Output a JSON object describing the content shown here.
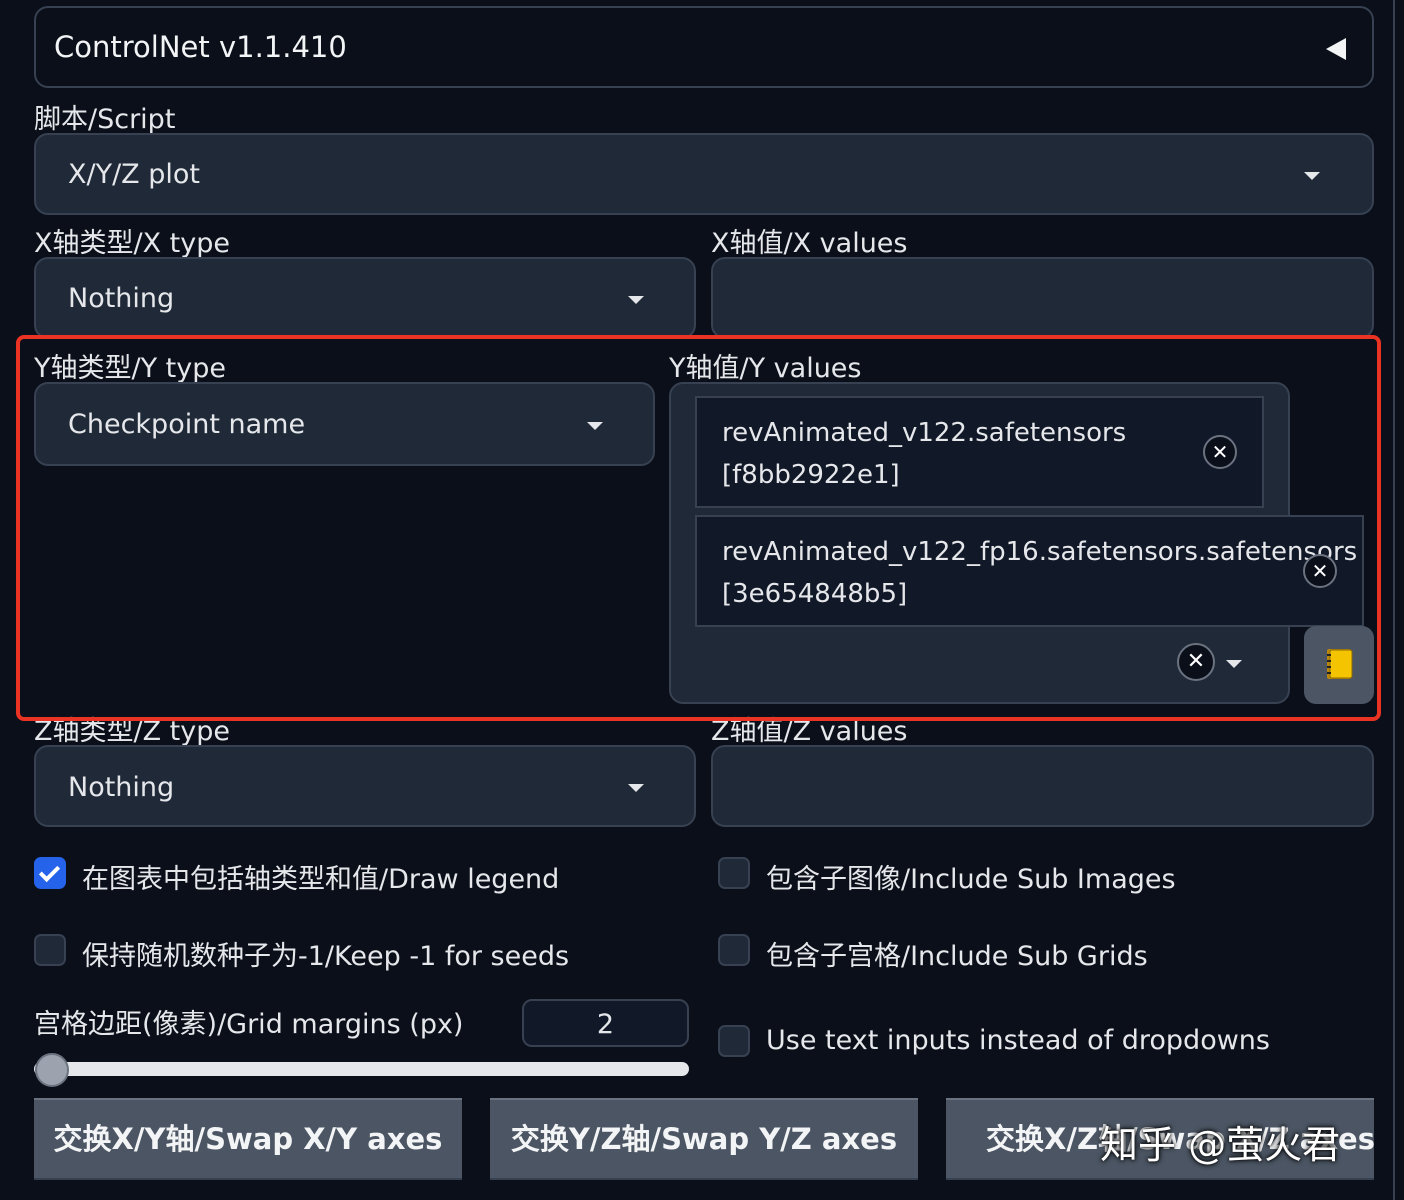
{
  "accordion": {
    "title": "ControlNet v1.1.410",
    "collapse_icon": "triangle-left-icon"
  },
  "script": {
    "label": "脚本/Script",
    "value": "X/Y/Z plot"
  },
  "x_axis": {
    "type_label": "X轴类型/X type",
    "type_value": "Nothing",
    "values_label": "X轴值/X values",
    "values_value": ""
  },
  "y_axis": {
    "type_label": "Y轴类型/Y type",
    "type_value": "Checkpoint name",
    "values_label": "Y轴值/Y values",
    "selected": [
      {
        "line1": "revAnimated_v122.safetensors",
        "line2": "[f8bb2922e1]"
      },
      {
        "line1": "revAnimated_v122_fp16.safetensors.safetensors",
        "line2": "[3e654848b5]"
      }
    ],
    "clear_icon": "close-icon",
    "open_icon": "chevron-down-icon",
    "fill_button_icon": "notebook-icon"
  },
  "z_axis": {
    "type_label": "Z轴类型/Z type",
    "type_value": "Nothing",
    "values_label": "Z轴值/Z values",
    "values_value": ""
  },
  "options": {
    "draw_legend": {
      "label": "在图表中包括轴类型和值/Draw legend",
      "checked": true
    },
    "include_sub_images": {
      "label": "包含子图像/Include Sub Images",
      "checked": false
    },
    "keep_seeds": {
      "label": "保持随机数种子为-1/Keep -1 for seeds",
      "checked": false
    },
    "include_sub_grids": {
      "label": "包含子宫格/Include Sub Grids",
      "checked": false
    },
    "text_inputs": {
      "label": "Use text inputs instead of dropdowns",
      "checked": false
    }
  },
  "grid_margins": {
    "label": "宫格边距(像素)/Grid margins (px)",
    "value": "2",
    "slider_fraction": 0.0
  },
  "buttons": {
    "swap_xy": "交换X/Y轴/Swap X/Y axes",
    "swap_yz": "交换Y/Z轴/Swap Y/Z axes",
    "swap_xz": "交换X/Z轴/Swap X/Z axes"
  },
  "watermark": "知乎 @萤火君",
  "colors": {
    "background": "#0b0f19",
    "input_bg": "#1f2937",
    "border": "#374151",
    "highlight_frame": "#ea3323",
    "checkbox_checked": "#2563eb"
  }
}
